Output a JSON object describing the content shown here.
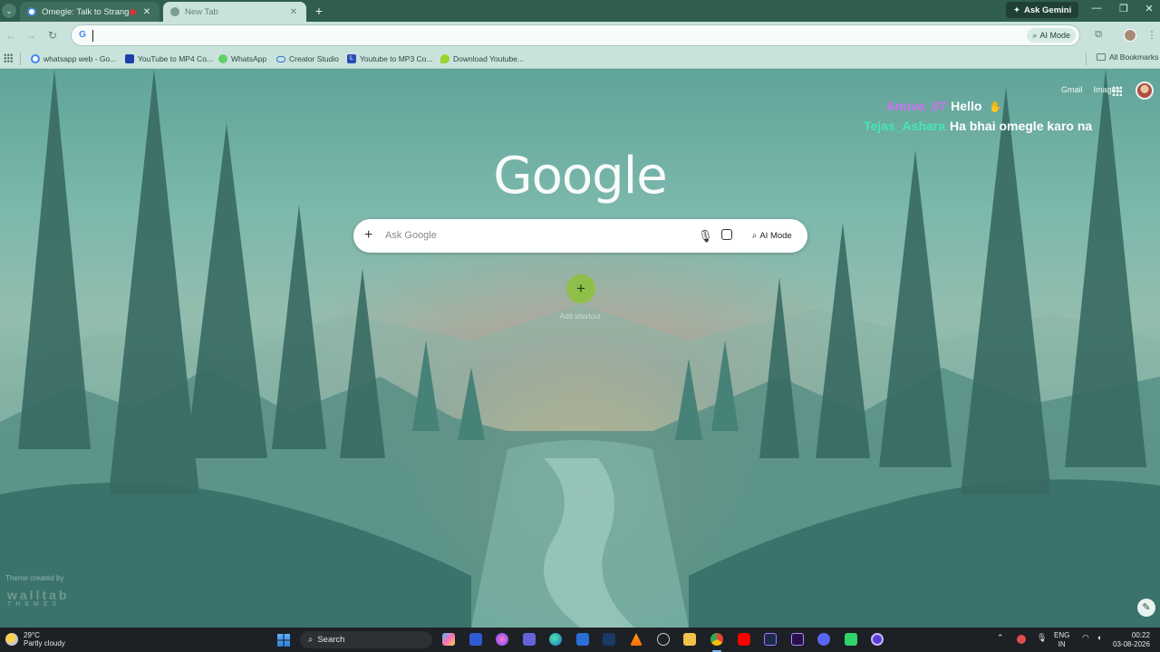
{
  "browser": {
    "tabs": [
      {
        "title": "Omegle: Talk to Strangers!",
        "active": false
      },
      {
        "title": "New Tab",
        "active": true
      }
    ],
    "ask_gemini_label": "Ask Gemini",
    "omnibox": {
      "value": "",
      "ai_mode_label": "AI Mode"
    },
    "bookmarks": [
      {
        "label": "whatsapp web - Go...",
        "icon": "google-icon"
      },
      {
        "label": "YouTube to MP4 Co...",
        "icon": "blue-doc-icon"
      },
      {
        "label": "WhatsApp",
        "icon": "whatsapp-icon"
      },
      {
        "label": "Creator Studio",
        "icon": "meta-icon"
      },
      {
        "label": "Youtube to MP3 Co...",
        "icon": "l-icon"
      },
      {
        "label": "Download Youtube...",
        "icon": "green-drop-icon"
      }
    ],
    "all_bookmarks_label": "All Bookmarks"
  },
  "ntp": {
    "links": {
      "gmail": "Gmail",
      "images": "Images"
    },
    "logo": "Google",
    "search_placeholder": "Ask Google",
    "ai_mode_label": "AI Mode",
    "shortcut_label": "Add shortcut",
    "theme_credit": "Theme created by",
    "theme_logo": "walltab",
    "theme_logo_sub": "THEMES"
  },
  "chat_overlay": [
    {
      "user": "Anuva_07",
      "message": "Hello",
      "color": "#d36ef2"
    },
    {
      "user": "Tejas_Ashara",
      "message": "Ha bhai omegle karo na",
      "color": "#45e7b2"
    }
  ],
  "taskbar": {
    "weather": {
      "temp": "29°C",
      "condition": "Partly cloudy"
    },
    "search_label": "Search",
    "lang": {
      "line1": "ENG",
      "line2": "IN"
    },
    "clock": {
      "time": "00:22",
      "date": "03-08-2026"
    }
  }
}
